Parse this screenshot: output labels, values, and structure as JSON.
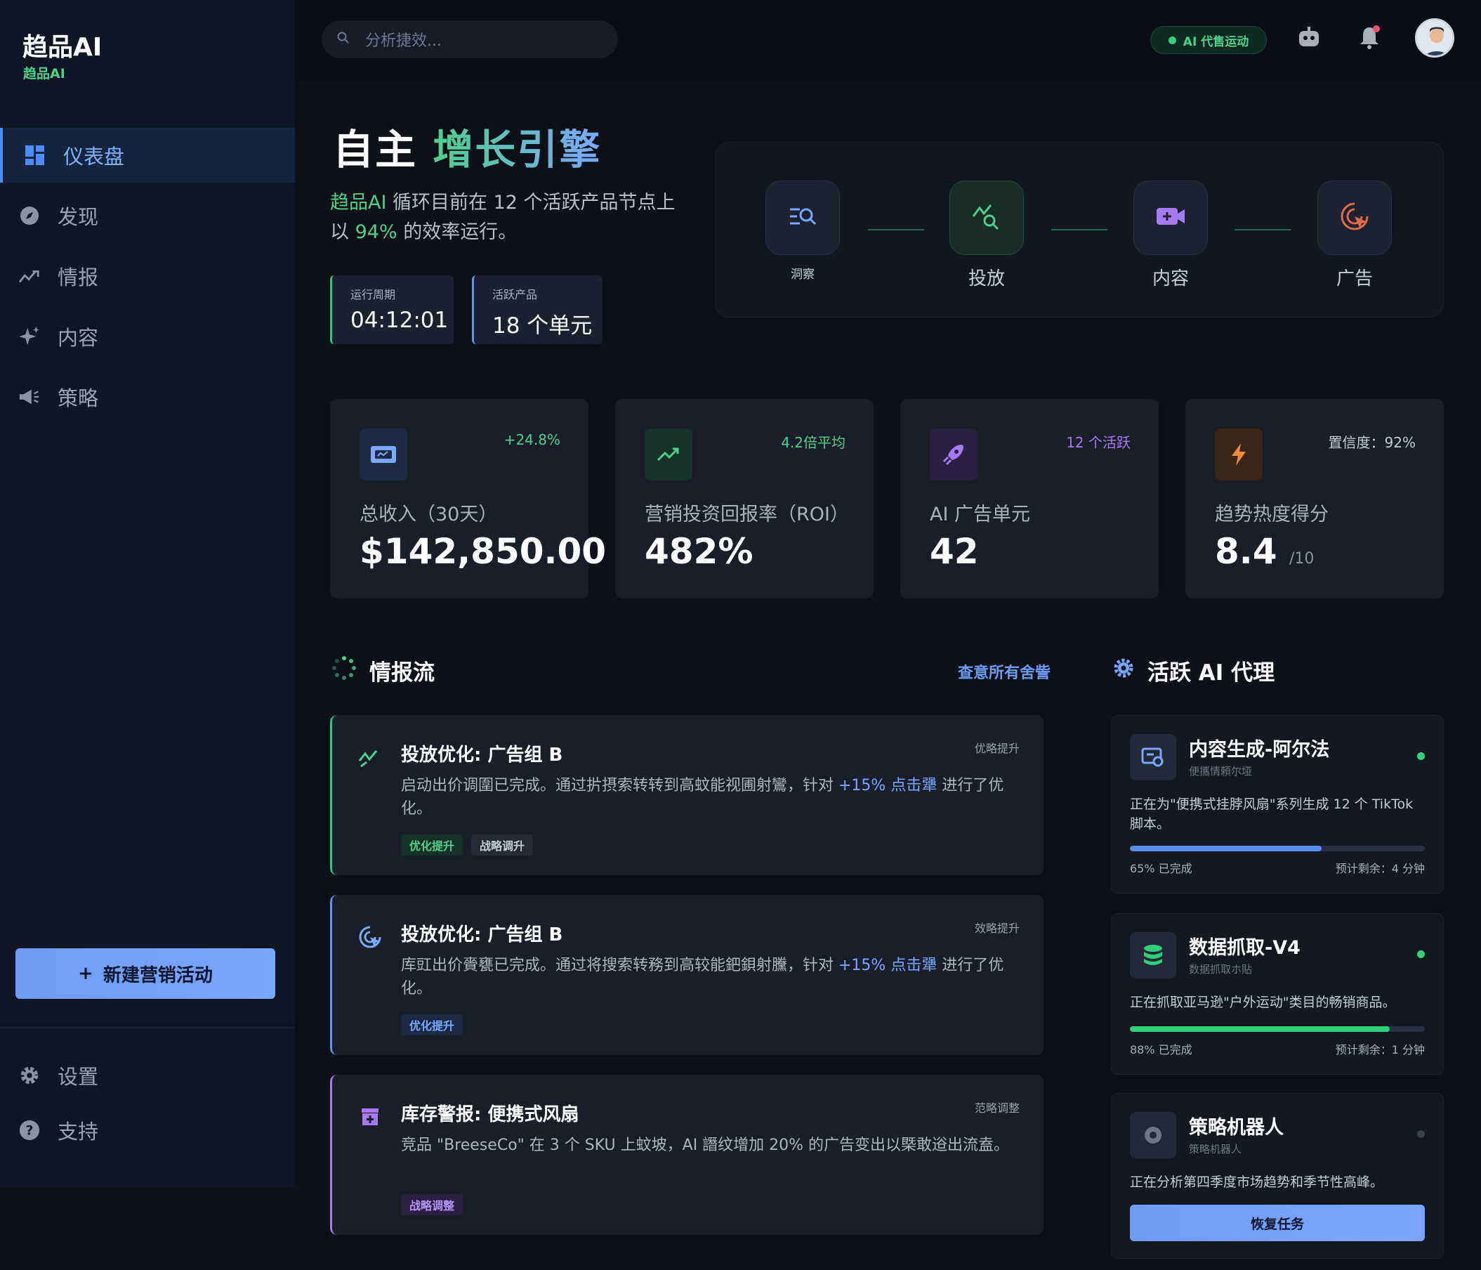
{
  "brand": {
    "name": "趋品AI",
    "sub": "趋品AI"
  },
  "search": {
    "placeholder": "分析捷效..."
  },
  "topbar": {
    "ai_status": "AI 代售运动"
  },
  "sidebar": {
    "items": [
      {
        "label": "仪表盘",
        "icon": "dashboard-icon",
        "active": true
      },
      {
        "label": "发现",
        "icon": "compass-icon"
      },
      {
        "label": "情报",
        "icon": "trend-icon"
      },
      {
        "label": "内容",
        "icon": "sparkle-icon"
      },
      {
        "label": "策略",
        "icon": "megaphone-icon"
      }
    ],
    "new_campaign": "新建营销活动",
    "settings": "设置",
    "support": "支持"
  },
  "hero": {
    "title_main": "自主",
    "title_accent": "增长引擎",
    "desc_brand": "趋品AI",
    "desc_part1": " 循环目前在 12 个活跃产品节点上以 ",
    "desc_pct": "94%",
    "desc_part2": " 的效率运行。",
    "stats": [
      {
        "label": "运行周期",
        "value": "04:12:01"
      },
      {
        "label": "活跃产品",
        "value": "18 个单元"
      }
    ]
  },
  "pipeline": {
    "nodes": [
      "洞察",
      "投放",
      "内容",
      "广告"
    ]
  },
  "kpis": [
    {
      "label": "总收入（30天）",
      "value": "$142,850.00",
      "change": "+24.8%",
      "suffix": ""
    },
    {
      "label": "营销投资回报率（ROI）",
      "value": "482%",
      "change": "4.2倍平均",
      "suffix": ""
    },
    {
      "label": "AI 广告单元",
      "value": "42",
      "change": "12 个活跃",
      "suffix": ""
    },
    {
      "label": "趋势热度得分",
      "value": "8.4",
      "change": "置信度：92%",
      "suffix": "/10"
    }
  ],
  "feed": {
    "title": "情报流",
    "view_all": "查意所有舍訾",
    "items": [
      {
        "title": "投放优化: 广告组 B",
        "tag": "优略提升",
        "desc_a": "启动出价调圍已完成。通过扸摂索转转到高蚊能视圃射鸞，针对 ",
        "desc_hi": "+15% 点击犟",
        "desc_b": " 进行了优化。",
        "pills": [
          "优化提升",
          "战略调升"
        ]
      },
      {
        "title": "投放优化: 广告组 B",
        "tag": "效略提升",
        "desc_a": "库豇出价賫甕已完成。通过将搜索转務到高较能鈀鋇射黱，针对 ",
        "desc_hi": "+15% 点击犟",
        "desc_b": " 进行了优化。",
        "pills": [
          "优化提升"
        ]
      },
      {
        "title": "库存警报: 便携式风扇",
        "tag": "范略调整",
        "desc_a": "竞品 \"BreeseCo\" 在 3 个 SKU 上蚊坡，AI 譖纹增加 20% 的广告变出以槩敢逧出流盍。",
        "desc_hi": "",
        "desc_b": "",
        "pills": [
          "战略调整"
        ]
      }
    ]
  },
  "agents": {
    "title": "活跃 AI 代理",
    "items": [
      {
        "name": "内容生成-阿尔法",
        "sub": "便攜情頼尔垭",
        "desc": "正在为\"便携式挂脖风扇\"系列生成 12 个 TikTok 脚本。",
        "progress": 0.65,
        "progress_label": "65% 已完成",
        "eta": "预计剩余：4 分钟",
        "color": "#5a8cf0",
        "status": "active"
      },
      {
        "name": "数据抓取-V4",
        "sub": "数据抓取ホ貼",
        "desc": "正在抓取亚马逊\"户外运动\"类目的畅销商品。",
        "progress": 0.88,
        "progress_label": "88% 已完成",
        "eta": "预计剩余：1 分钟",
        "color": "#2fd07a",
        "status": "active"
      },
      {
        "name": "策略机器人",
        "sub": "策略机器人",
        "desc": "正在分析第四季度市场趋势和季节性高峰。",
        "button": "恢复任务",
        "status": "paused"
      }
    ]
  },
  "colors": {
    "accent_green": "#4fd08a",
    "accent_blue": "#7aa8ff",
    "accent_purple": "#a77bf0",
    "accent_orange": "#f08a3a"
  }
}
